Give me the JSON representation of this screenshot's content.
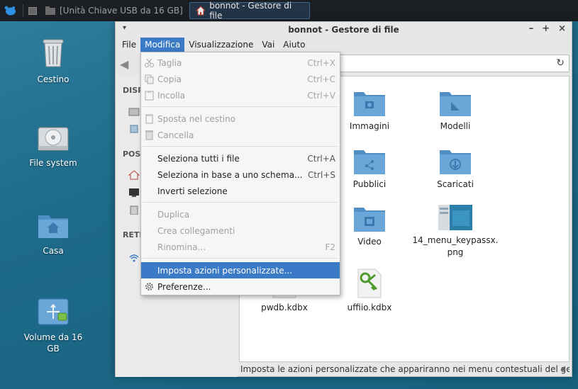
{
  "panel": {
    "tasks": [
      {
        "label": "[Unità Chiave USB da 16 GB]"
      },
      {
        "label": "bonnot - Gestore di file"
      }
    ]
  },
  "desktop": {
    "icons": [
      {
        "label": "Cestino"
      },
      {
        "label": "File system"
      },
      {
        "label": "Casa"
      },
      {
        "label": "Volume da 16\nGB"
      }
    ]
  },
  "window": {
    "title": "bonnot - Gestore di file",
    "menubar": [
      "File",
      "Modifica",
      "Visualizzazione",
      "Vai",
      "Aiuto"
    ],
    "sidebar_headers": [
      "DISP",
      "POS",
      "RETE"
    ],
    "files": [
      {
        "label": "Immagini",
        "icon": "folder-pictures-icon"
      },
      {
        "label": "Modelli",
        "icon": "folder-templates-icon"
      },
      {
        "label": "Pubblici",
        "icon": "folder-public-icon"
      },
      {
        "label": "Scaricati",
        "icon": "folder-download-icon"
      },
      {
        "label": "Video",
        "icon": "folder-video-icon"
      },
      {
        "label": "14_menu_keypassx.\npng",
        "icon": "image-thumbnail-icon"
      },
      {
        "label": "pwdb.kdbx",
        "icon": "document-icon"
      },
      {
        "label": "uffiio.kdbx",
        "icon": "keepassx-file-icon"
      }
    ],
    "status": "Imposta le azioni personalizzate che appariranno nei menu contestuali del ge..."
  },
  "dropdown": {
    "items": [
      {
        "label": "Taglia",
        "accel": "Ctrl+X",
        "icon": "scissors-icon",
        "disabled": true
      },
      {
        "label": "Copia",
        "accel": "Ctrl+C",
        "icon": "copy-icon",
        "disabled": true
      },
      {
        "label": "Incolla",
        "accel": "Ctrl+V",
        "icon": "paste-icon",
        "disabled": true
      },
      {
        "label": "Sposta nel cestino",
        "accel": "",
        "icon": "trash-move-icon",
        "disabled": true
      },
      {
        "label": "Cancella",
        "accel": "",
        "icon": "delete-icon",
        "disabled": true
      },
      {
        "label": "Seleziona tutti i file",
        "accel": "Ctrl+A",
        "icon": "",
        "disabled": false
      },
      {
        "label": "Seleziona in base a uno schema...",
        "accel": "Ctrl+S",
        "icon": "",
        "disabled": false
      },
      {
        "label": "Inverti selezione",
        "accel": "",
        "icon": "",
        "disabled": false
      },
      {
        "label": "Duplica",
        "accel": "",
        "icon": "",
        "disabled": true
      },
      {
        "label": "Crea collegamenti",
        "accel": "",
        "icon": "",
        "disabled": true
      },
      {
        "label": "Rinomina...",
        "accel": "F2",
        "icon": "",
        "disabled": true
      },
      {
        "label": "Imposta azioni personalizzate...",
        "accel": "",
        "icon": "",
        "disabled": false,
        "highlighted": true
      },
      {
        "label": "Preferenze...",
        "accel": "",
        "icon": "gear-icon",
        "disabled": false
      }
    ]
  },
  "colors": {
    "accent": "#3b7ac7",
    "folder": "#5b9bd1",
    "panel": "#1b1f23"
  }
}
